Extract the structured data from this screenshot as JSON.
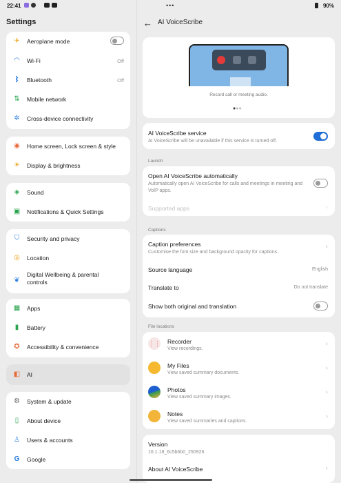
{
  "status": {
    "time": "22:41",
    "battery": "90%"
  },
  "left": {
    "title": "Settings",
    "groups": [
      [
        {
          "label": "Aeroplane mode",
          "icon": "airplane-icon"
        },
        {
          "label": "Wi-Fi",
          "value": "Off",
          "icon": "wifi-icon"
        },
        {
          "label": "Bluetooth",
          "value": "Off",
          "icon": "bluetooth-icon"
        },
        {
          "label": "Mobile network",
          "icon": "mobile-network-icon"
        },
        {
          "label": "Cross-device connectivity",
          "icon": "cross-device-icon"
        }
      ],
      [
        {
          "label": "Home screen, Lock screen & style",
          "icon": "palette-icon"
        },
        {
          "label": "Display & brightness",
          "icon": "sun-icon"
        }
      ],
      [
        {
          "label": "Sound",
          "icon": "sound-icon"
        },
        {
          "label": "Notifications & Quick Settings",
          "icon": "notification-icon"
        }
      ],
      [
        {
          "label": "Security and privacy",
          "icon": "shield-icon"
        },
        {
          "label": "Location",
          "icon": "location-icon"
        },
        {
          "label": "Digital Wellbeing & parental controls",
          "icon": "wellbeing-icon"
        }
      ],
      [
        {
          "label": "Apps",
          "icon": "apps-icon"
        },
        {
          "label": "Battery",
          "icon": "battery-icon"
        },
        {
          "label": "Accessibility & convenience",
          "icon": "accessibility-icon"
        }
      ],
      [
        {
          "label": "AI",
          "icon": "ai-icon"
        }
      ],
      [
        {
          "label": "System & update",
          "icon": "gear-icon"
        },
        {
          "label": "About device",
          "icon": "phone-icon"
        },
        {
          "label": "Users & accounts",
          "icon": "user-icon"
        },
        {
          "label": "Google",
          "icon": "google-icon"
        }
      ]
    ]
  },
  "right": {
    "title": "AI VoiceScribe",
    "hero_caption": "Record call or meeting audio.",
    "service": {
      "title": "AI VoiceScribe service",
      "sub": "AI VoiceScribe will be unavailable if this service is turned off."
    },
    "launch": {
      "section": "Launch",
      "auto_title": "Open AI VoiceScribe automatically",
      "auto_sub": "Automatically open AI VoiceScribe for calls and meetings in meeting and VoIP apps.",
      "supported": "Supported apps"
    },
    "captions": {
      "section": "Captions",
      "pref_title": "Caption preferences",
      "pref_sub": "Customise the font size and background opacity for captions.",
      "source_label": "Source language",
      "source_value": "English",
      "translate_label": "Translate to",
      "translate_value": "Do not translate",
      "both_label": "Show both original and translation"
    },
    "files": {
      "section": "File locations",
      "items": [
        {
          "title": "Recorder",
          "sub": "View recordings.",
          "icon": "recorder-icon"
        },
        {
          "title": "My Files",
          "sub": "View saved summary documents.",
          "icon": "folder-icon"
        },
        {
          "title": "Photos",
          "sub": "View saved summary images.",
          "icon": "photos-icon"
        },
        {
          "title": "Notes",
          "sub": "View saved summaries and captions.",
          "icon": "notes-icon"
        }
      ]
    },
    "version": {
      "label": "Version",
      "value": "16.1.18_6c5b6b0_250926"
    },
    "about": "About AI VoiceScribe"
  }
}
